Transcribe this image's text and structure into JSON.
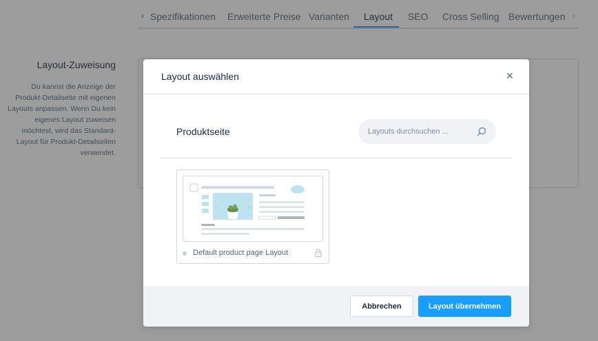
{
  "tabs": {
    "items": [
      {
        "label": "Spezifikationen"
      },
      {
        "label": "Erweiterte Preise"
      },
      {
        "label": "Varianten"
      },
      {
        "label": "Layout"
      },
      {
        "label": "SEO"
      },
      {
        "label": "Cross Selling"
      },
      {
        "label": "Bewertungen"
      }
    ],
    "active": "Layout",
    "prev_icon": "chevron-left-icon",
    "next_icon": "chevron-right-icon"
  },
  "layout_assignment": {
    "title": "Layout-Zuweisung",
    "description": "Du kannst die Anzeige der Produkt-Detailseite mit eigenen Layouts anpassen. Wenn Du kein eigenes Layout zuweisen möchtest, wird das Standard-Layout für Produkt-Detailseiten verwendet."
  },
  "modal": {
    "title": "Layout auswählen",
    "close_icon": "close-icon",
    "section_title": "Produktseite",
    "search": {
      "placeholder": "Layouts durchsuchen ...",
      "value": "",
      "icon": "search-icon"
    },
    "layouts": [
      {
        "name": "Default product page Layout",
        "locked": true,
        "lock_icon": "lock-icon"
      }
    ],
    "footer": {
      "cancel_label": "Abbrechen",
      "apply_label": "Layout übernehmen"
    }
  },
  "colors": {
    "accent": "#189eff",
    "text": "#52667a",
    "heading": "#1a2a3a",
    "border": "#d1d9e0",
    "footer_bg": "#f0f2f5"
  }
}
